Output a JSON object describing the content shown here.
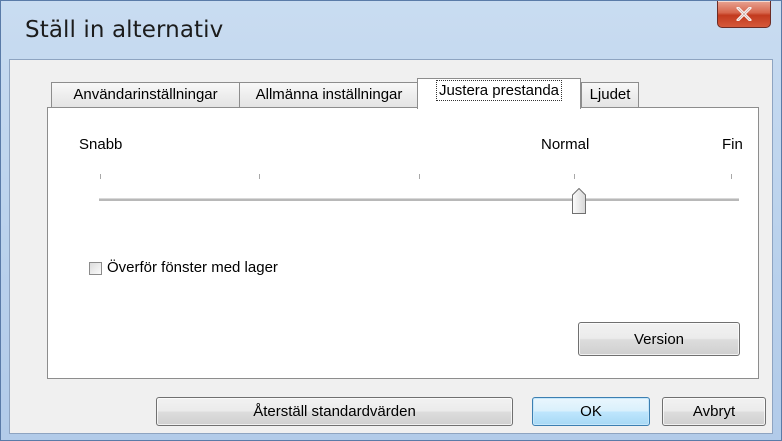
{
  "window": {
    "title": "Ställ in alternativ"
  },
  "tabs": [
    {
      "label": "Användarinställningar",
      "active": false
    },
    {
      "label": "Allmänna inställningar",
      "active": false
    },
    {
      "label": "Justera prestanda",
      "active": true
    },
    {
      "label": "Ljudet",
      "active": false
    }
  ],
  "performance": {
    "slider_labels": {
      "left": "Snabb",
      "middle": "Normal",
      "right": "Fin"
    },
    "slider_position": 0.75,
    "slider_steps": 5,
    "checkbox": {
      "label": "Överför fönster med lager",
      "checked": false
    },
    "version_button": "Version"
  },
  "footer": {
    "reset_button": "Återställ standardvärden",
    "ok_button": "OK",
    "cancel_button": "Avbryt"
  },
  "icons": {
    "close": "close-icon"
  },
  "colors": {
    "title_bar": "#b9d1ec",
    "close_button": "#c23a1e",
    "default_button": "#3c7fb1"
  }
}
